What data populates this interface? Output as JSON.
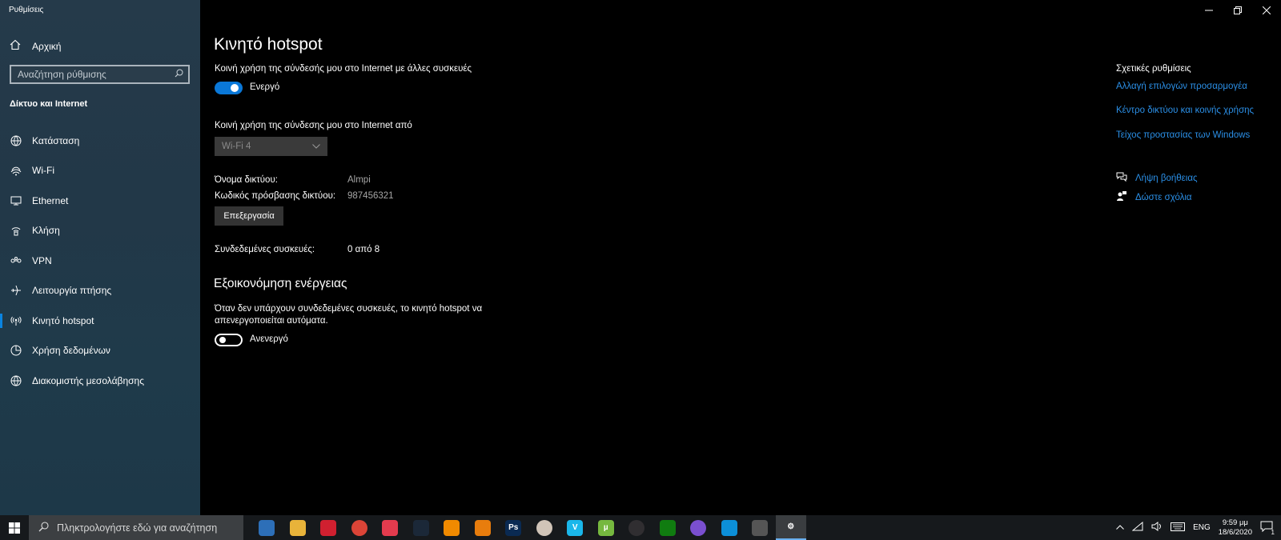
{
  "window": {
    "title": "Ρυθμίσεις",
    "controls": {
      "minimize": "minimize",
      "restore": "restore",
      "close": "close"
    }
  },
  "sidebar": {
    "home_label": "Αρχική",
    "search_placeholder": "Αναζήτηση ρύθμισης",
    "section_title": "Δίκτυο και Internet",
    "items": [
      {
        "label": "Κατάσταση",
        "icon": "globe-status-icon"
      },
      {
        "label": "Wi-Fi",
        "icon": "wifi-icon"
      },
      {
        "label": "Ethernet",
        "icon": "ethernet-icon"
      },
      {
        "label": "Κλήση",
        "icon": "dialup-icon"
      },
      {
        "label": "VPN",
        "icon": "vpn-icon"
      },
      {
        "label": "Λειτουργία πτήσης",
        "icon": "airplane-icon"
      },
      {
        "label": "Κινητό hotspot",
        "icon": "hotspot-icon",
        "selected": true
      },
      {
        "label": "Χρήση δεδομένων",
        "icon": "data-usage-icon"
      },
      {
        "label": "Διακομιστής μεσολάβησης",
        "icon": "globe-icon"
      }
    ]
  },
  "main": {
    "title": "Κινητό hotspot",
    "share_label": "Κοινή χρήση της σύνδεσής μου στο Internet με άλλες συσκευές",
    "share_toggle_state": "Ενεργό",
    "share_from_label": "Κοινή χρήση της σύνδεσης μου στο Internet από",
    "share_from_value": "Wi-Fi 4",
    "network_name_label": "Όνομα δικτύου:",
    "network_name_value": "Almpi",
    "password_label": "Κωδικός πρόσβασης δικτύου:",
    "password_value": "987456321",
    "edit_button": "Επεξεργασία",
    "connected_label": "Συνδεδεμένες συσκευές:",
    "connected_value": "0 από 8",
    "power_title": "Εξοικονόμηση ενέργειας",
    "power_desc_line1": "Όταν δεν υπάρχουν συνδεδεμένες συσκευές, το κινητό hotspot να",
    "power_desc_line2": "απενεργοποιείται αυτόματα.",
    "power_toggle_state": "Ανενεργό"
  },
  "related": {
    "title": "Σχετικές ρυθμίσεις",
    "links": [
      "Αλλαγή επιλογών προσαρμογέα",
      "Κέντρο δικτύου και κοινής χρήσης",
      "Τείχος προστασίας των Windows"
    ],
    "help": "Λήψη βοήθειας",
    "feedback": "Δώστε σχόλια"
  },
  "taskbar": {
    "search_placeholder": "Πληκτρολογήστε εδώ για αναζήτηση",
    "apps": [
      {
        "name": "cortana-app",
        "color": "#2d6fb8"
      },
      {
        "name": "file-explorer-app",
        "color": "#e8b33a"
      },
      {
        "name": "red-app",
        "color": "#d02030"
      },
      {
        "name": "chrome-app",
        "color": "#db4437"
      },
      {
        "name": "media-app",
        "color": "#e33b4e"
      },
      {
        "name": "steam-app",
        "color": "#1b2838"
      },
      {
        "name": "vlc-app",
        "color": "#f08a00"
      },
      {
        "name": "blender-app",
        "color": "#e87d0d"
      },
      {
        "name": "photoshop-app",
        "color": "#0a2a52"
      },
      {
        "name": "circle-app",
        "color": "#d0c4b8"
      },
      {
        "name": "vimeo-app",
        "color": "#1ab7ea"
      },
      {
        "name": "utorrent-app",
        "color": "#76b83f"
      },
      {
        "name": "obs-app",
        "color": "#302e31"
      },
      {
        "name": "xbox-app",
        "color": "#107c10"
      },
      {
        "name": "color-app",
        "color": "#7a4fd0"
      },
      {
        "name": "edge-app",
        "color": "#0c8fd8"
      },
      {
        "name": "calculator-app",
        "color": "#555"
      },
      {
        "name": "settings-app",
        "color": "#3a3d40",
        "active": true
      }
    ],
    "tray": {
      "language": "ENG",
      "time": "9:59 μμ",
      "date": "18/6/2020",
      "notifications": "1"
    }
  }
}
